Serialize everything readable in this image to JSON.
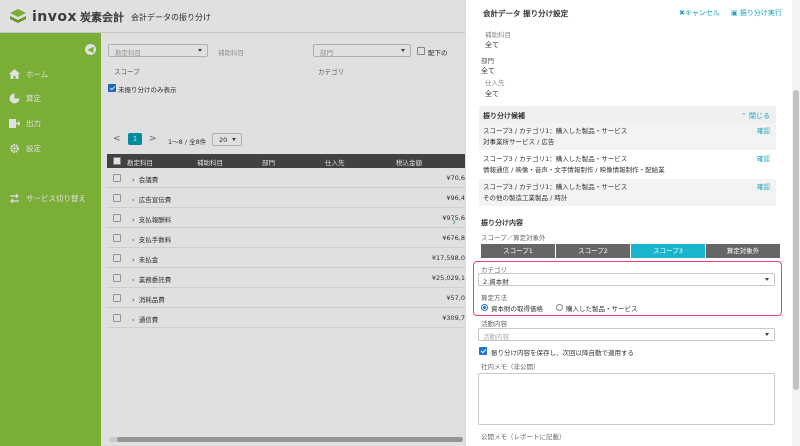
{
  "app": {
    "logo_text": "invox",
    "logo_sub": "炭素会計",
    "page_title": "会計データの振り分け",
    "brand_color": "#8dc63f",
    "accent_color": "#19b5cc"
  },
  "sidebar": {
    "toggle_icon": "arrow-left-circle-icon",
    "items": [
      {
        "label": "ホーム",
        "icon": "home-icon"
      },
      {
        "label": "算定",
        "icon": "pie-chart-icon"
      },
      {
        "label": "出力",
        "icon": "export-icon"
      },
      {
        "label": "設定",
        "icon": "gear-icon"
      },
      {
        "label": "サービス切り替え",
        "icon": "switch-icon"
      }
    ]
  },
  "filters": {
    "account_placeholder": "勘定科目",
    "sub_account_placeholder": "補助科目",
    "department_placeholder": "部門",
    "scope_placeholder": "スコープ",
    "category_placeholder": "カテゴリ",
    "sub_checkbox_label": "配下の",
    "unassigned_only_label": "未振り分けのみ表示",
    "unassigned_only_checked": true
  },
  "pager": {
    "prev": "<",
    "current": "1",
    "next": ">",
    "summary": "1〜8 / 全8件",
    "per_page": "20"
  },
  "table": {
    "headers": [
      "勘定科目",
      "補助科目",
      "部門",
      "仕入先",
      "税込金額"
    ],
    "rows": [
      {
        "name": "会議費",
        "amount": "¥70,6"
      },
      {
        "name": "広告宣伝費",
        "amount": "¥96,4"
      },
      {
        "name": "支払報酬料",
        "amount": "¥975,6"
      },
      {
        "name": "支払手数料",
        "amount": "¥676,8"
      },
      {
        "name": "未払金",
        "amount": "¥17,598,0"
      },
      {
        "name": "業務委託費",
        "amount": "¥25,029,1"
      },
      {
        "name": "消耗品費",
        "amount": "¥57,0"
      },
      {
        "name": "通信費",
        "amount": "¥309,7"
      }
    ]
  },
  "panel": {
    "title": "会計データ 振り分け設定",
    "cancel_label": "キャンセル",
    "execute_label": "振り分け実行",
    "sub_account_label": "補助科目",
    "sub_account_value": "全て",
    "department_label": "部門",
    "department_value": "全て",
    "supplier_label": "仕入先",
    "supplier_value": "全て",
    "candidates_title": "振り分け候補",
    "candidates_close": "閉じる",
    "candidates": [
      {
        "line1": "スコープ3 / カテゴリ1：購入した製品・サービス",
        "line2": "対事業所サービス / 広告",
        "action": "確認"
      },
      {
        "line1": "スコープ3 / カテゴリ1：購入した製品・サービス",
        "line2": "情報通信 / 映像・音声・文字情報制作 / 映像情報制作・配給業",
        "action": "確認"
      },
      {
        "line1": "スコープ3 / カテゴリ1：購入した製品・サービス",
        "line2": "その他の製造工業製品 / 時計",
        "action": "確認"
      }
    ],
    "content_title": "振り分け内容",
    "scope_label": "スコープ／算定対象外",
    "scope_tabs": [
      "スコープ1",
      "スコープ2",
      "スコープ3",
      "算定対象外"
    ],
    "scope_selected": "スコープ3",
    "category_label": "カテゴリ",
    "category_value": "2.資本財",
    "method_label": "算定方法",
    "method_options": [
      "資本財の取得価格",
      "購入した製品・サービス"
    ],
    "method_selected": "資本財の取得価格",
    "activity_label": "活動内容",
    "activity_placeholder": "活動内容",
    "save_rule_label": "振り分け内容を保存し、次回以降自動で適用する",
    "save_rule_checked": true,
    "internal_memo_label": "社内メモ（非公開）",
    "public_memo_label": "公開メモ（レポートに記載）"
  }
}
